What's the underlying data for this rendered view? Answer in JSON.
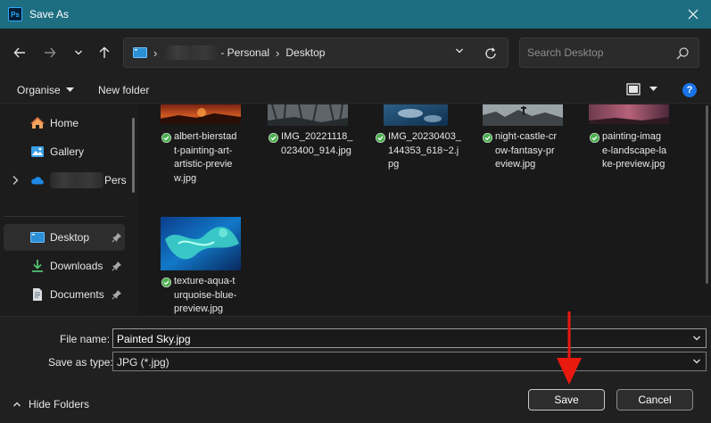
{
  "window": {
    "app_icon_text": "Ps",
    "title": "Save As"
  },
  "address_bar": {
    "path": [
      {
        "label": "- Personal"
      },
      {
        "label": "Desktop"
      }
    ]
  },
  "search": {
    "placeholder": "Search Desktop"
  },
  "toolbar": {
    "organise_label": "Organise",
    "new_folder_label": "New folder"
  },
  "sidebar": {
    "items": [
      {
        "label": "Home",
        "icon": "home-icon"
      },
      {
        "label": "Gallery",
        "icon": "gallery-icon"
      },
      {
        "label": "Pers",
        "icon": "onedrive-icon"
      },
      {
        "label": "Desktop",
        "icon": "desktop-icon",
        "selected": true,
        "pinned": true
      },
      {
        "label": "Downloads",
        "icon": "downloads-icon",
        "pinned": true
      },
      {
        "label": "Documents",
        "icon": "documents-icon",
        "pinned": true
      }
    ]
  },
  "files": [
    {
      "lines": [
        "albert-bierstad",
        "t-painting-art-",
        "artistic-previe",
        "w.jpg"
      ]
    },
    {
      "lines": [
        "IMG_20221118_",
        "023400_914.jpg"
      ]
    },
    {
      "lines": [
        "IMG_20230403_",
        "144353_618~2.j",
        "pg"
      ]
    },
    {
      "lines": [
        "night-castle-cr",
        "ow-fantasy-pr",
        "eview.jpg"
      ]
    },
    {
      "lines": [
        "painting-imag",
        "e-landscape-la",
        "ke-preview.jpg"
      ]
    },
    {
      "lines": [
        "texture-aqua-t",
        "urquoise-blue-",
        "preview.jpg"
      ]
    }
  ],
  "form": {
    "file_name_label": "File name:",
    "file_name_value": "Painted Sky.jpg",
    "save_as_type_label": "Save as type:",
    "save_as_type_value": "JPG (*.jpg)",
    "hide_folders_label": "Hide Folders",
    "save_label": "Save",
    "cancel_label": "Cancel"
  },
  "colors": {
    "titlebar": "#1e6e82",
    "synced": "#4caf50",
    "annotation": "#e8190f"
  }
}
